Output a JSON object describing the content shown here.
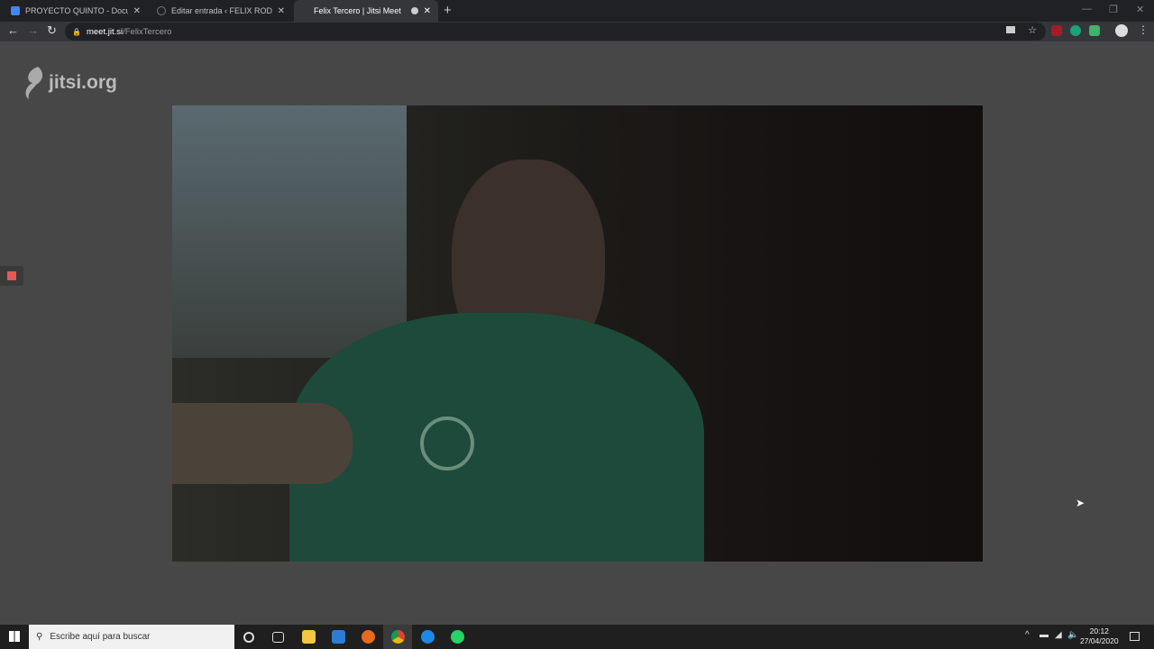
{
  "browser": {
    "tabs": [
      {
        "title": "PROYECTO QUINTO - Documento",
        "icon": "docs-icon",
        "active": false
      },
      {
        "title": "Editar entrada ‹ FELIX RODRIGUEZ",
        "icon": "wordpress-icon",
        "active": false
      },
      {
        "title": "Felix Tercero | Jitsi Meet",
        "icon": "recording-icon",
        "active": true
      }
    ],
    "url_host": "meet.jit.si",
    "url_path": "/FelixTercero"
  },
  "page": {
    "logo": "jitsi.org",
    "recording_color": "#e85656"
  },
  "taskbar": {
    "search_placeholder": "Escribe aquí para buscar",
    "time": "20:12",
    "date": "27/04/2020"
  }
}
